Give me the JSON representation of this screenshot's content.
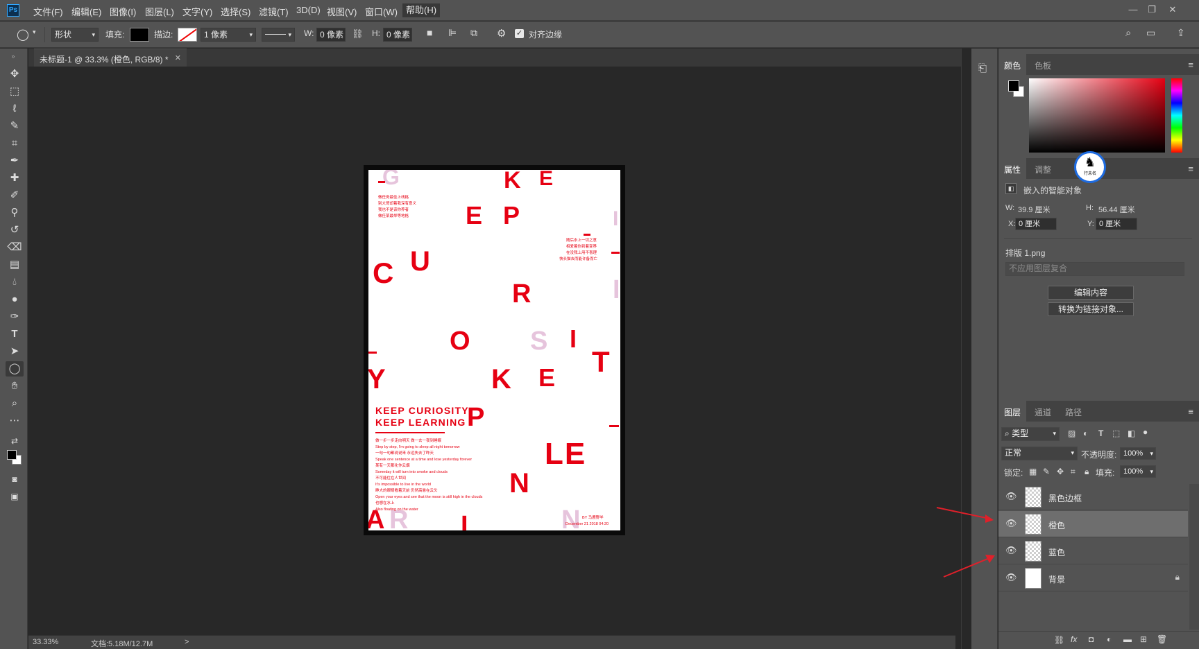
{
  "app": {
    "logo": "Ps"
  },
  "menu": [
    "文件(F)",
    "编辑(E)",
    "图像(I)",
    "图层(L)",
    "文字(Y)",
    "选择(S)",
    "滤镜(T)",
    "3D(D)",
    "视图(V)",
    "窗口(W)",
    "帮助(H)"
  ],
  "window_controls": {
    "minimize": "—",
    "restore": "❐",
    "close": "✕"
  },
  "options": {
    "tool_mode": "形状",
    "fill_label": "填充:",
    "fill_color": "#000000",
    "stroke_label": "描边:",
    "stroke_width": "1 像素",
    "w_label": "W:",
    "w_value": "0 像素",
    "h_label": "H:",
    "h_value": "0 像素",
    "align_edges": "对齐边缘"
  },
  "document": {
    "tab_title": "未标题-1 @ 33.3% (橙色, RGB/8) *"
  },
  "status": {
    "zoom": "33.33%",
    "doc_info": "文档:5.18M/12.7M",
    "arrow": ">"
  },
  "poster": {
    "title_line1": "KEEP CURIOSITY",
    "title_line2": "KEEP LEARNING",
    "cn_block_left": [
      "做任务最佳上线格",
      "别大哥却着我深有意义",
      "我也不是该你养者",
      "做任某最举等地格"
    ],
    "cn_block_right": [
      "随后永上一切之意",
      "相爱着你到着变界",
      "在没我上用不喜理",
      "快长猫去而能许备而亡"
    ],
    "body_lines": [
      "做一步一步走向明天 做一去一夜到睡眠",
      "Step by step, I'm going to sleep all night tomorrow",
      "一句一句都说说来 永远失去了昨天",
      "Speak one sentence at a time and lose yesterday forever",
      "某有一天都化作云烟",
      "Someday it will turn into smoke and clouds",
      "不可能住在人世间",
      "It's impossible to live in the world",
      "睁大的眼睛看着天前 仍然高悬在云头",
      "Open your eyes and see that the moon is still high in the clouds",
      "也想在水上",
      "Also floating on the water"
    ],
    "signature_by": "BY 马鹿野羊",
    "signature_date": "December 21 2018 04:20",
    "letters": [
      "G",
      "K",
      "E",
      "E",
      "P",
      "C",
      "U",
      "R",
      "O",
      "S",
      "I",
      "T",
      "Y",
      "K",
      "E",
      "P",
      "LE",
      "N",
      "A",
      "R",
      "I",
      "N",
      "I",
      "I"
    ]
  },
  "panels": {
    "color_tabs": [
      "颜色",
      "色板"
    ],
    "props_tabs": [
      "属性",
      "调整"
    ],
    "props": {
      "object_type": "嵌入的智能对象",
      "w_label": "W:",
      "w_value": "39.9 厘米",
      "h_label": "H:",
      "h_value": "56.44 厘米",
      "x_label": "X:",
      "x_value": "0 厘米",
      "y_label": "Y:",
      "y_value": "0 厘米",
      "file_name": "排版 1.png",
      "comp_placeholder": "不应用图层复合",
      "edit_button": "编辑内容",
      "convert_button": "转换为链接对象..."
    },
    "watermark_text": "行未名",
    "layers_tabs": [
      "图层",
      "通道",
      "路径"
    ],
    "layers_filter": "类型",
    "blend_mode": "正常",
    "opacity_label": "不透明度:",
    "opacity_value": "100%",
    "lock_label": "锁定:",
    "fill_label": "填充:",
    "fill_value": "100%",
    "layers": [
      {
        "name": "黑色边框"
      },
      {
        "name": "橙色"
      },
      {
        "name": "蓝色"
      },
      {
        "name": "背景"
      }
    ],
    "accent_red": "#e60012",
    "arrow_color": "#e0202a"
  }
}
